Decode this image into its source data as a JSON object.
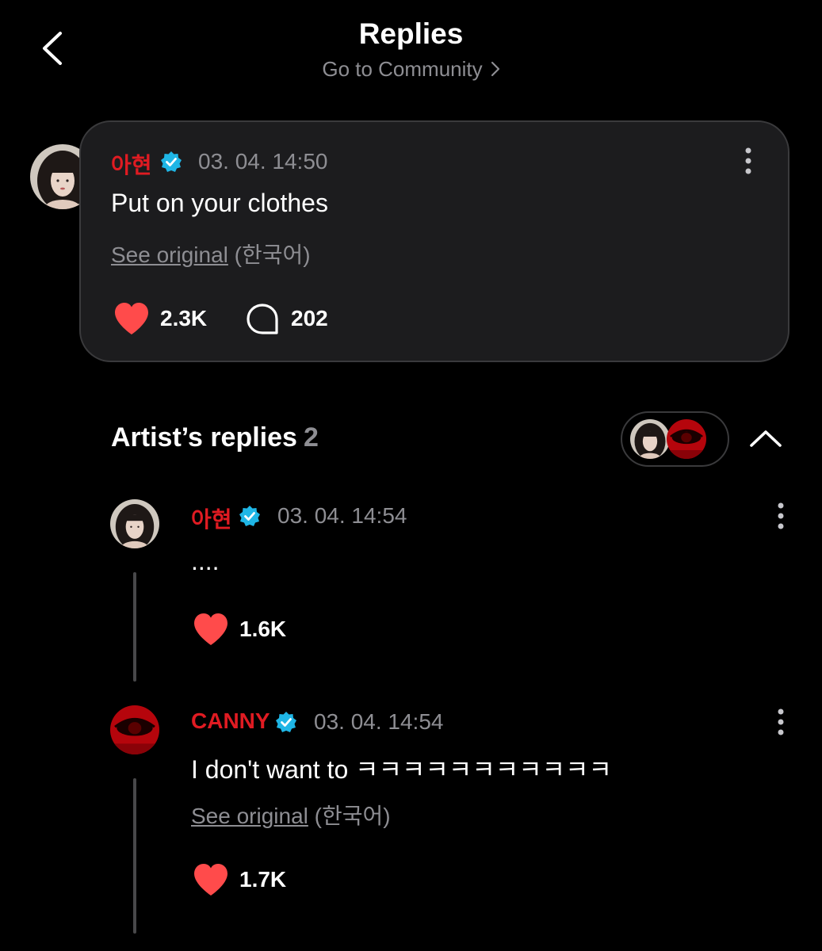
{
  "header": {
    "title": "Replies",
    "community_link": "Go to Community"
  },
  "post": {
    "author": "아현",
    "timestamp": "03. 04. 14:50",
    "text": "Put on your clothes",
    "see_original": "See original",
    "original_language": "(한국어)",
    "likes": "2.3K",
    "comments": "202"
  },
  "artist_replies": {
    "title": "Artist’s replies",
    "count": "2",
    "replies": [
      {
        "author": "아현",
        "timestamp": "03. 04. 14:54",
        "text": "....",
        "likes": "1.6K"
      },
      {
        "author": "CANNY",
        "timestamp": "03. 04. 14:54",
        "text": "I don't want to ㅋㅋㅋㅋㅋㅋㅋㅋㅋㅋㅋ",
        "see_original": "See original",
        "original_language": "(한국어)",
        "likes": "1.7K"
      }
    ]
  },
  "colors": {
    "background": "#000000",
    "card": "#1c1c1e",
    "author_name": "#e01b22",
    "verified_badge": "#1fb6e6",
    "heart": "#ff4b4b",
    "muted_text": "#8e8e93"
  },
  "icons": [
    "back-chevron-icon",
    "chevron-right-icon",
    "verified-badge-icon",
    "more-vertical-icon",
    "heart-icon",
    "comment-bubble-icon",
    "chevron-up-icon"
  ]
}
